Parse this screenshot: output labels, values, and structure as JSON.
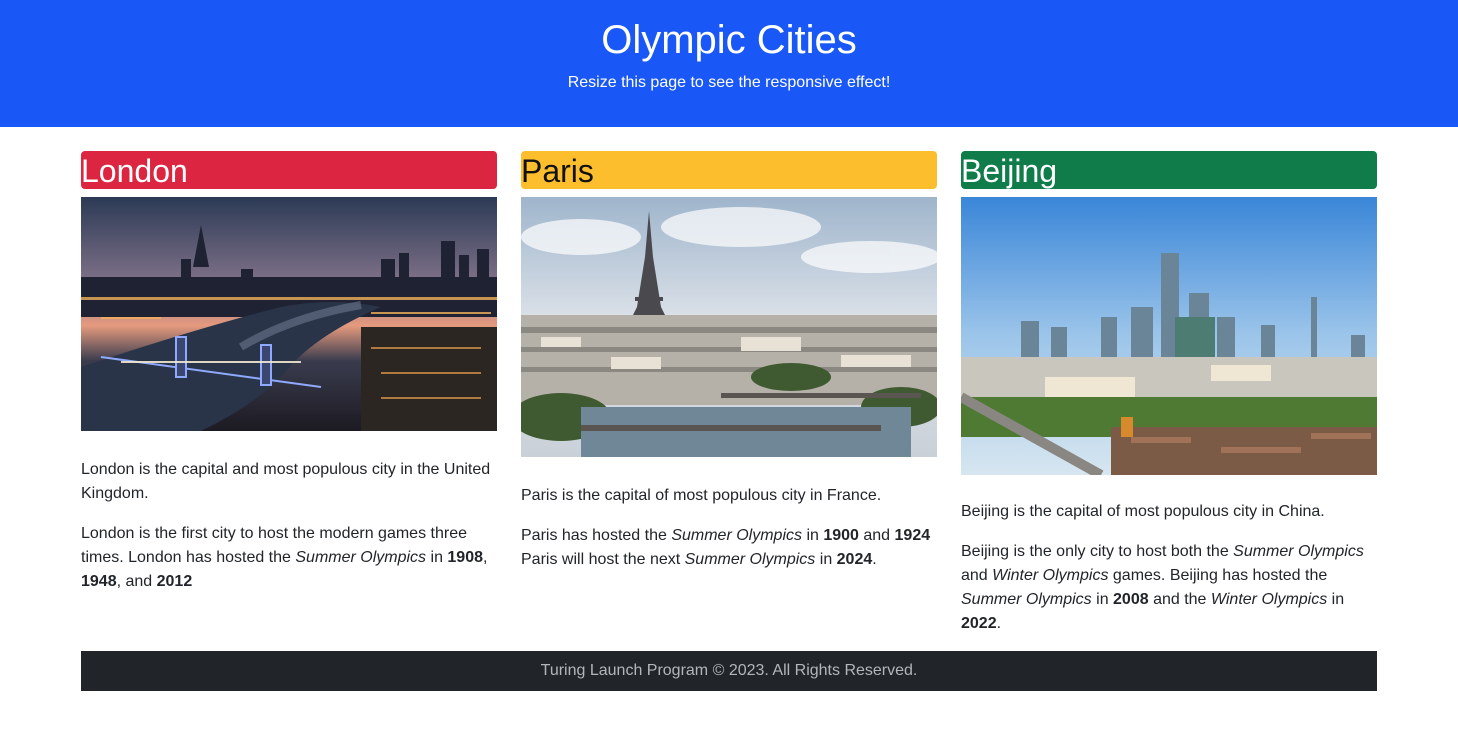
{
  "header": {
    "title": "Olympic Cities",
    "subtitle": "Resize this page to see the responsive effect!"
  },
  "cities": [
    {
      "name": "London",
      "color": "#dc2641",
      "paragraph1": "London is the capital and most populous city in the United Kingdom.",
      "p2_a": "London is the first city to host the modern games three times. London has hosted the ",
      "p2_event": "Summer Olympics",
      "p2_b": " in ",
      "year1": "1908",
      "p2_c": ", ",
      "year2": "1948",
      "p2_d": ", and ",
      "year3": "2012"
    },
    {
      "name": "Paris",
      "color": "#fdbe2e",
      "paragraph1": "Paris is the capital of most populous city in France.",
      "p2_a": "Paris has hosted the ",
      "p2_event": "Summer Olympics",
      "p2_b": " in ",
      "year1": "1900",
      "p2_c": " and ",
      "year2": "1924",
      "p2_d": " Paris will host the next ",
      "p2_event2": "Summer Olympics",
      "p2_e": " in ",
      "year3": "2024",
      "p2_f": "."
    },
    {
      "name": "Beijing",
      "color": "#0f7c49",
      "paragraph1": "Beijing is the capital of most populous city in China.",
      "p2_a": "Beijing is the only city to host both the ",
      "p2_event": "Summer Olympics",
      "p2_b": " and ",
      "p2_event2": "Winter Olympics",
      "p2_c": " games. Beijing has hosted the ",
      "p2_event3": "Summer Olympics",
      "p2_d": " in ",
      "year1": "2008",
      "p2_e": " and the ",
      "p2_event4": "Winter Olympics",
      "p2_f": " in ",
      "year2": "2022",
      "p2_g": "."
    }
  ],
  "footer": {
    "text": "Turing Launch Program © 2023. All Rights Reserved."
  }
}
